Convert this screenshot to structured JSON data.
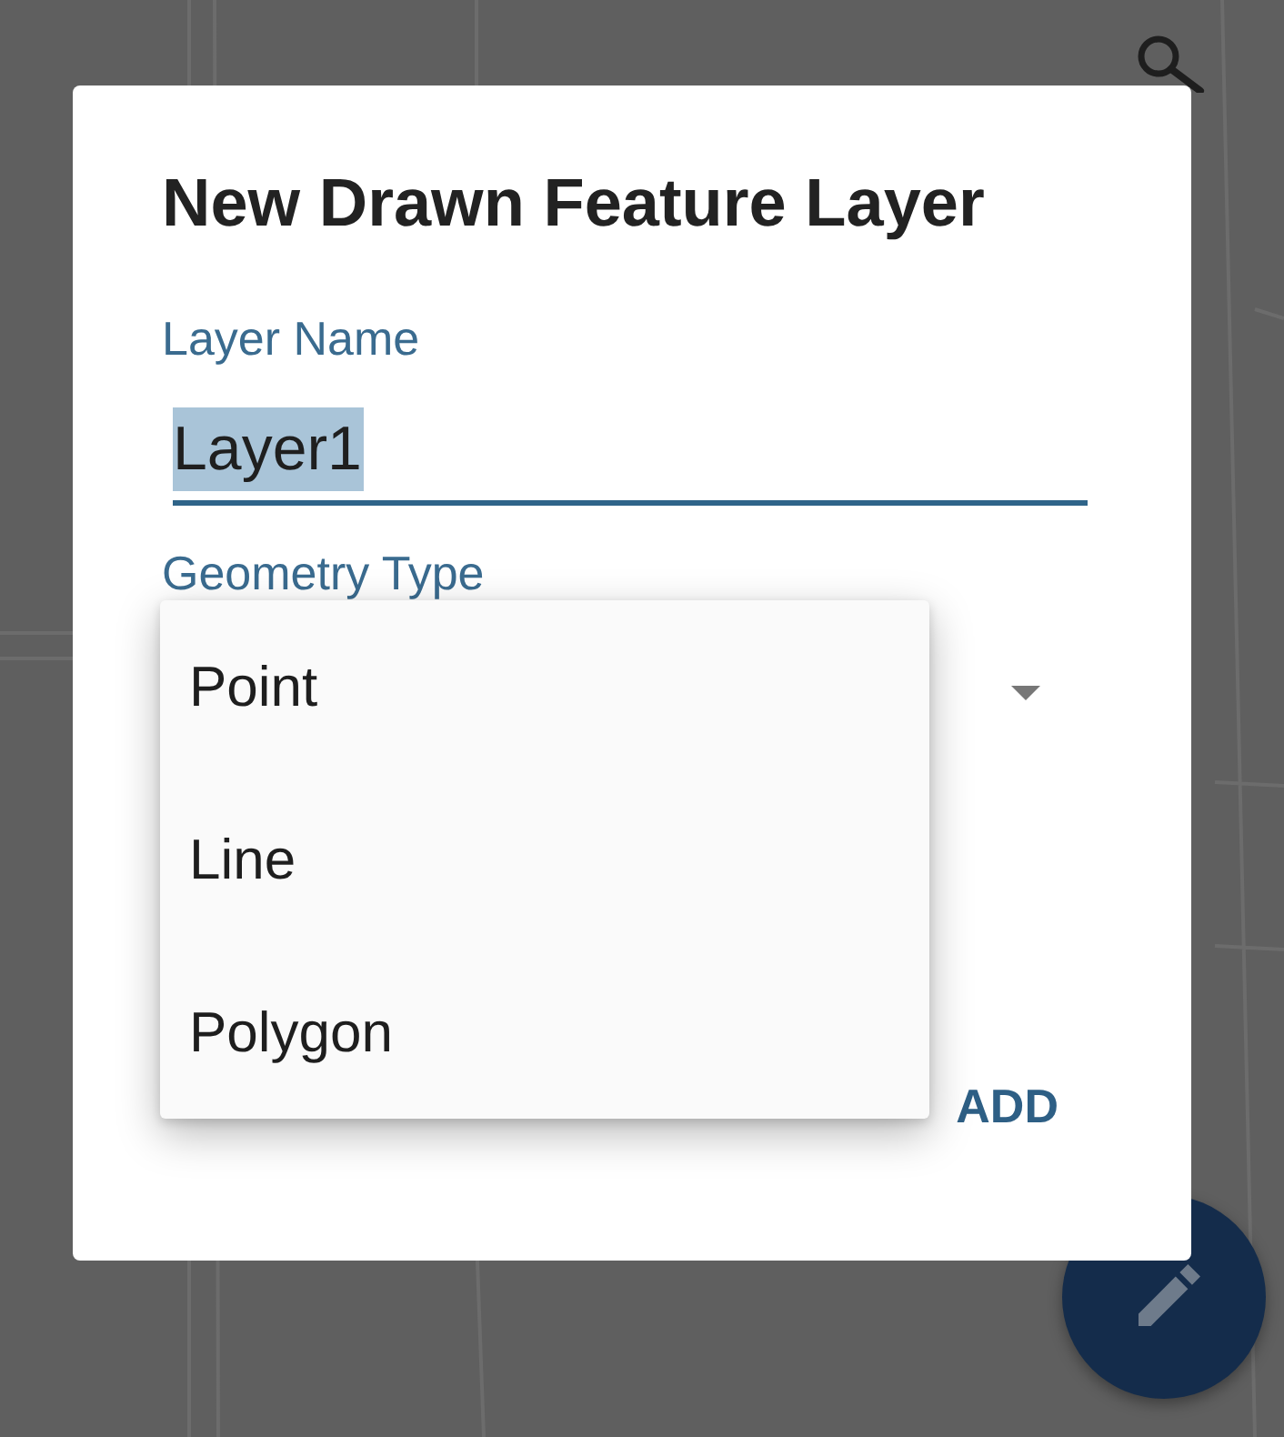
{
  "dialog": {
    "title": "New Drawn Feature Layer",
    "layer_name": {
      "label": "Layer Name",
      "value": "Layer1",
      "text_selected": true
    },
    "geometry_type": {
      "label": "Geometry Type",
      "expanded": true,
      "options": [
        {
          "label": "Point",
          "selected": false
        },
        {
          "label": "Line",
          "selected": false
        },
        {
          "label": "Polygon",
          "selected": false
        }
      ]
    },
    "buttons": [
      {
        "label": "ADD"
      }
    ]
  }
}
